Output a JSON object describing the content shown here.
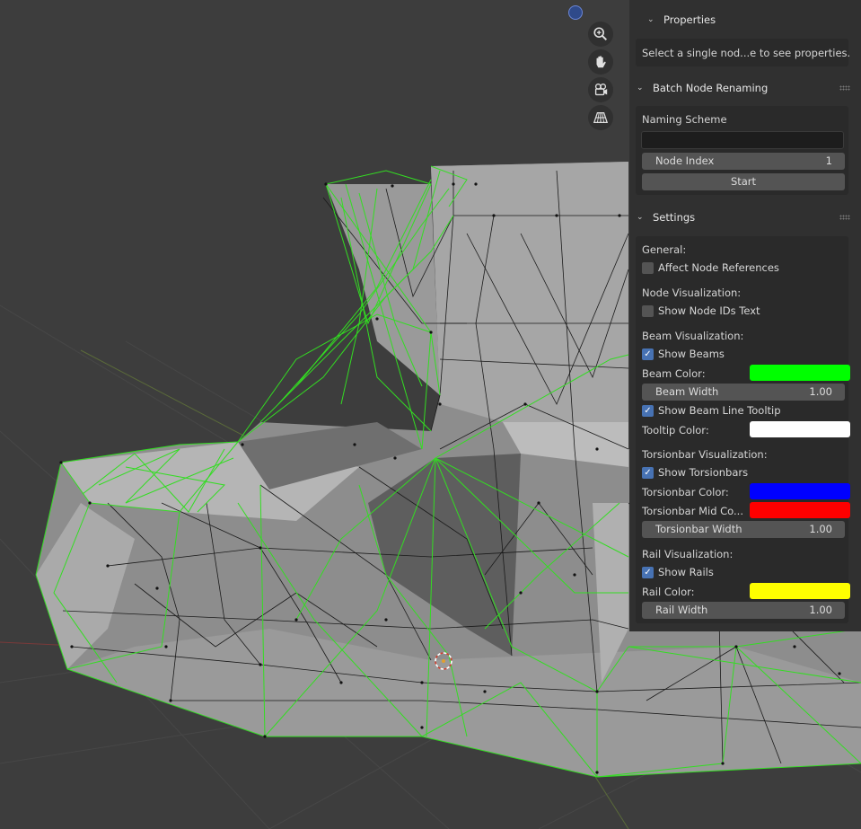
{
  "panel": {
    "properties": {
      "title": "Properties",
      "message": "Select a single nod...e to see properties."
    },
    "batch": {
      "title": "Batch Node Renaming",
      "naming_scheme_label": "Naming Scheme",
      "naming_scheme_value": "",
      "node_index_label": "Node Index",
      "node_index_value": "1",
      "start_label": "Start"
    },
    "settings": {
      "title": "Settings",
      "general_label": "General:",
      "affect_node_refs_label": "Affect Node References",
      "affect_node_refs_checked": false,
      "node_vis_label": "Node Visualization:",
      "show_node_ids_label": "Show Node IDs Text",
      "show_node_ids_checked": false,
      "beam_vis_label": "Beam Visualization:",
      "show_beams_label": "Show Beams",
      "show_beams_checked": true,
      "beam_color_label": "Beam Color:",
      "beam_color": "#00ff00",
      "beam_width_label": "Beam Width",
      "beam_width_value": "1.00",
      "show_tooltip_label": "Show Beam Line Tooltip",
      "show_tooltip_checked": true,
      "tooltip_color_label": "Tooltip Color:",
      "tooltip_color": "#ffffff",
      "torsion_vis_label": "Torsionbar Visualization:",
      "show_torsion_label": "Show Torsionbars",
      "show_torsion_checked": true,
      "torsion_color_label": "Torsionbar Color:",
      "torsion_color": "#0000ff",
      "torsion_mid_label": "Torsionbar Mid Co...",
      "torsion_mid_color": "#ff0000",
      "torsion_width_label": "Torsionbar Width",
      "torsion_width_value": "1.00",
      "rail_vis_label": "Rail Visualization:",
      "show_rails_label": "Show Rails",
      "show_rails_checked": true,
      "rail_color_label": "Rail Color:",
      "rail_color": "#ffff00",
      "rail_width_label": "Rail Width",
      "rail_width_value": "1.00"
    }
  },
  "viewport_nav": [
    "zoom-icon",
    "pan-hand-icon",
    "camera-view-icon",
    "perspective-grid-icon"
  ],
  "accent_color": "#4772b3",
  "mesh_wire_color": "#33dd22"
}
